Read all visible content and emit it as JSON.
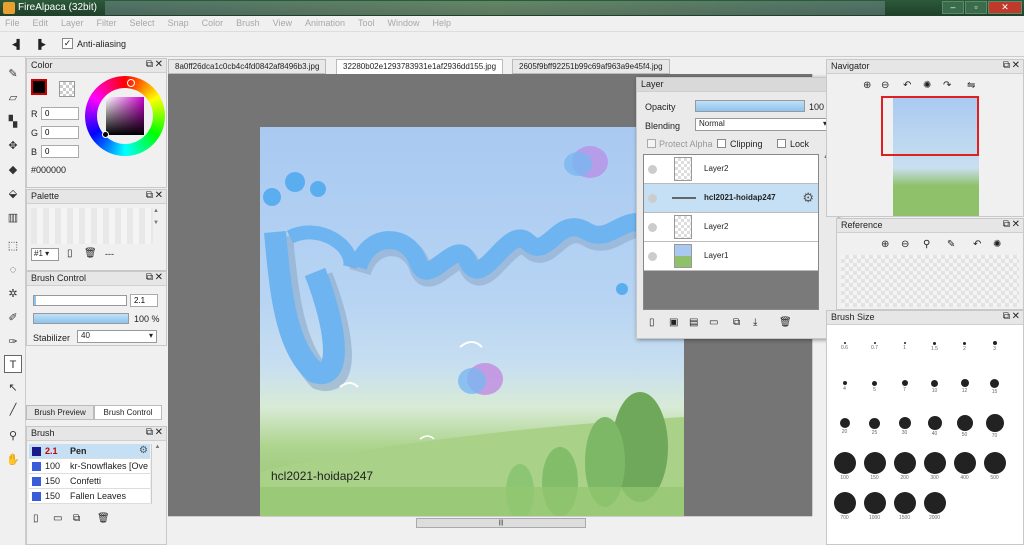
{
  "app": {
    "title": "FireAlpaca (32bit)"
  },
  "menu": [
    "File",
    "Edit",
    "Layer",
    "Filter",
    "Select",
    "Snap",
    "Color",
    "Brush",
    "View",
    "Animation",
    "Tool",
    "Window",
    "Help"
  ],
  "toolbar": {
    "antialias_label": "Anti-aliasing"
  },
  "color_panel": {
    "title": "Color",
    "r_label": "R",
    "r": "0",
    "g_label": "G",
    "g": "0",
    "b_label": "B",
    "b": "0",
    "hex": "#000000",
    "fg": "#000000"
  },
  "palette_panel": {
    "title": "Palette",
    "selector": "#1",
    "dash": "---"
  },
  "brush_control": {
    "title": "Brush Control",
    "size": "2.1",
    "opacity": "100 %",
    "stabilizer_label": "Stabilizer",
    "stabilizer": "40"
  },
  "brush_tabs": {
    "preview": "Brush Preview",
    "control": "Brush Control"
  },
  "brush_panel": {
    "title": "Brush",
    "items": [
      {
        "size": "2.1",
        "name": "Pen",
        "color": "#1a1a8a"
      },
      {
        "size": "100",
        "name": "kr-Snowflakes [Ove",
        "color": "#3a5cd8"
      },
      {
        "size": "150",
        "name": "Confetti",
        "color": "#3a5cd8"
      },
      {
        "size": "150",
        "name": "Fallen Leaves",
        "color": "#3a5cd8"
      }
    ]
  },
  "tabs": [
    "8a0ff26dca1c0cb4c4fd0842af8496b3.jpg",
    "32280b02e1293783931e1af2936dd155.jpg",
    "2605f9bff92251b99c69af963a9e45f4.jpg"
  ],
  "canvas": {
    "watermark": "hcl2021-hoidap247"
  },
  "layer_panel": {
    "title": "Layer",
    "opacity_label": "Opacity",
    "opacity": "100 %",
    "blending_label": "Blending",
    "blending": "Normal",
    "protect_alpha": "Protect Alpha",
    "clipping": "Clipping",
    "lock": "Lock",
    "layers": [
      {
        "name": "Layer2"
      },
      {
        "name": "hcl2021-hoidap247"
      },
      {
        "name": "Layer2"
      },
      {
        "name": "Layer1"
      }
    ]
  },
  "navigator": {
    "title": "Navigator"
  },
  "reference": {
    "title": "Reference"
  },
  "brush_size": {
    "title": "Brush Size",
    "sizes": [
      "0.6",
      "0.7",
      "1",
      "1.5",
      "2",
      "3",
      "4",
      "5",
      "7",
      "10",
      "12",
      "15",
      "20",
      "25",
      "30",
      "40",
      "50",
      "70",
      "100",
      "150",
      "200",
      "300",
      "400",
      "500",
      "700",
      "1000",
      "1500",
      "2000"
    ]
  }
}
